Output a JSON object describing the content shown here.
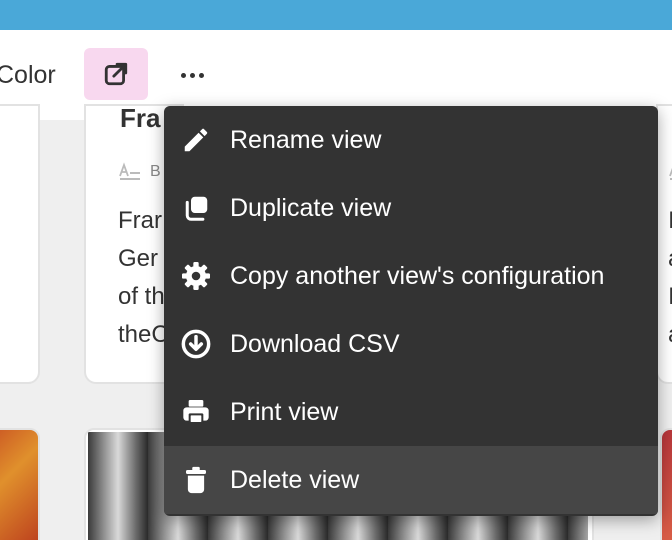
{
  "toolbar": {
    "color_label": "Color",
    "share_icon": "share-external-icon",
    "more_icon": "more-horizontal-icon",
    "colors": {
      "topbar": "#4aa8d8",
      "share_bg": "#f8d8ef"
    }
  },
  "cards": {
    "mid_title": "Fra",
    "mid_field_label": "B",
    "mid_body": [
      "Frar",
      "Ger",
      "of th",
      "theC"
    ],
    "right_body": [
      "I",
      "a",
      "I",
      "a"
    ]
  },
  "menu": {
    "items": [
      {
        "label": "Rename view",
        "icon": "pencil-icon"
      },
      {
        "label": "Duplicate view",
        "icon": "duplicate-icon"
      },
      {
        "label": "Copy another view's configuration",
        "icon": "gear-icon"
      },
      {
        "label": "Download CSV",
        "icon": "download-icon"
      },
      {
        "label": "Print view",
        "icon": "printer-icon"
      },
      {
        "label": "Delete view",
        "icon": "trash-icon",
        "highlighted": true
      }
    ],
    "colors": {
      "background": "#333333",
      "highlight": "#464646",
      "text": "#ffffff"
    }
  }
}
